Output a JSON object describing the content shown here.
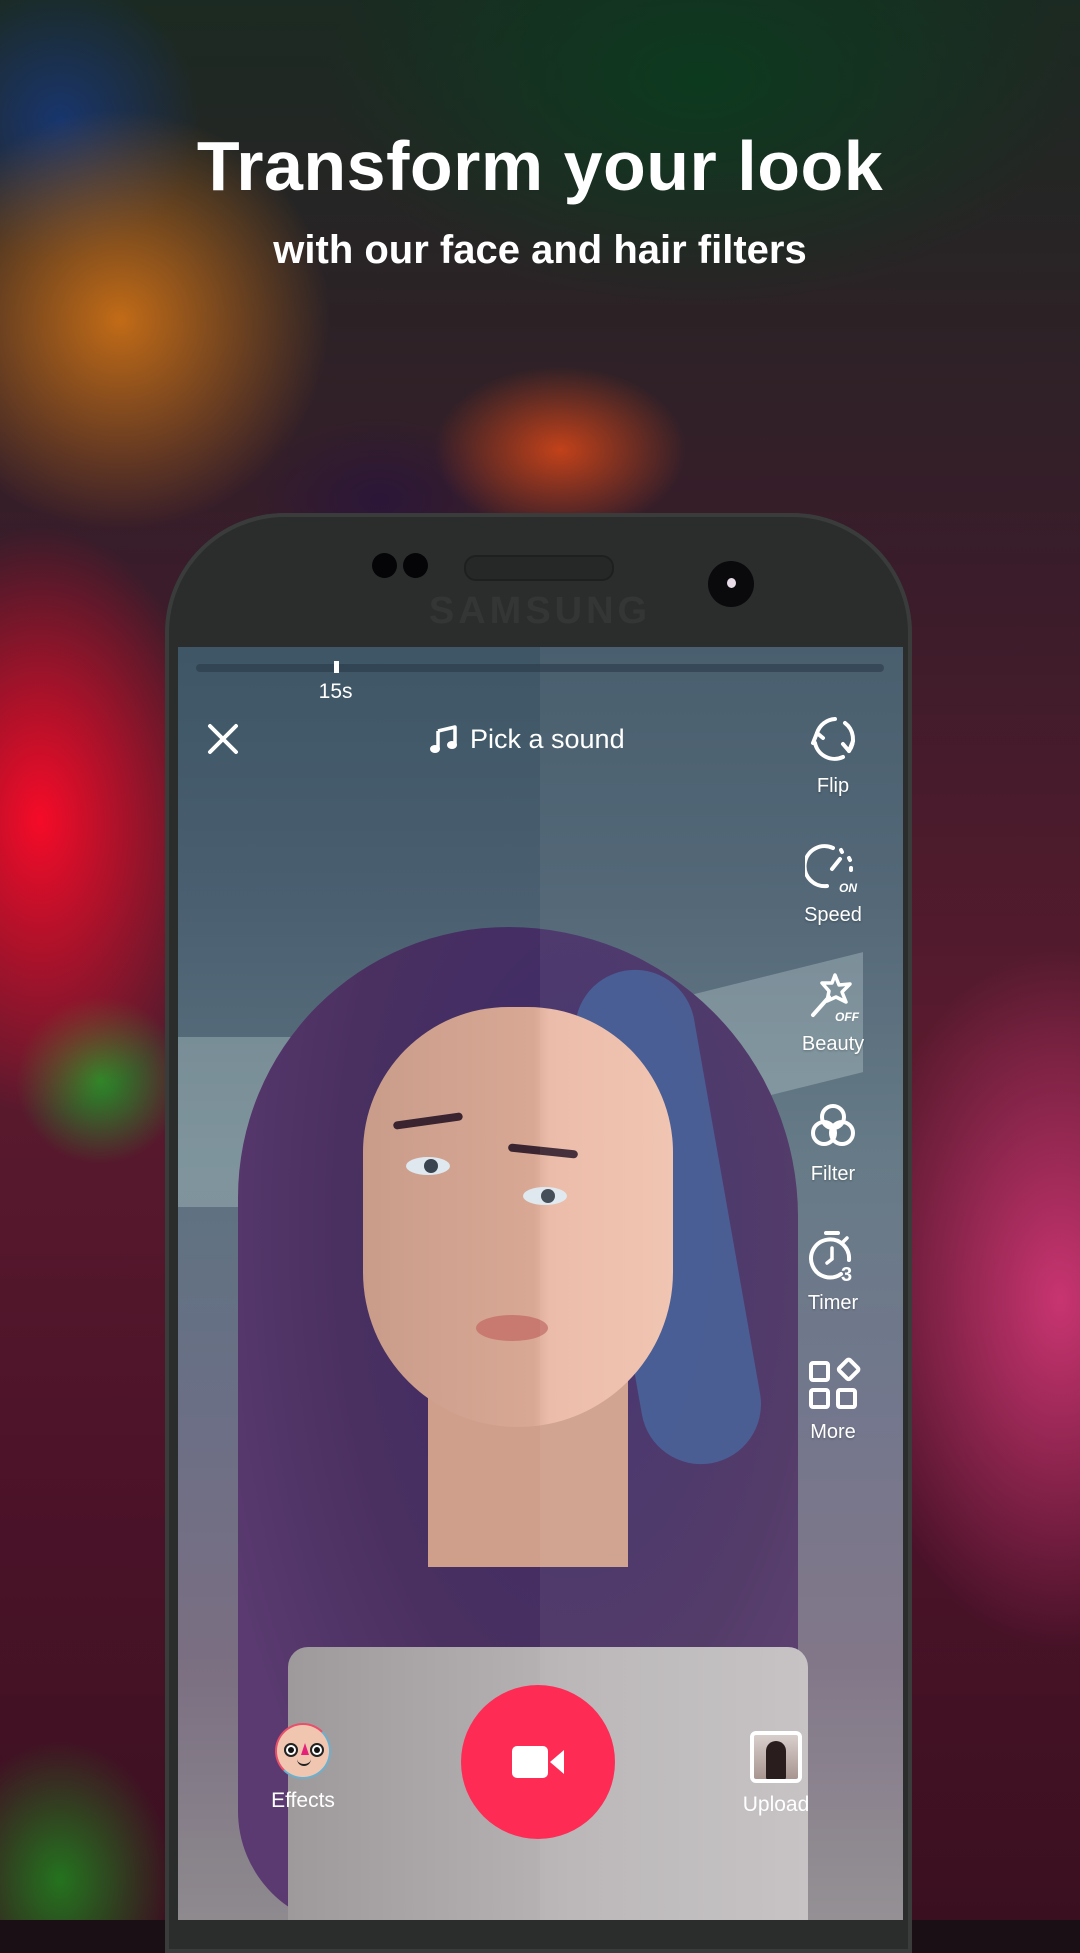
{
  "promo": {
    "headline": "Transform your look",
    "subline": "with our face and hair filters"
  },
  "device": {
    "brand": "SAMSUNG"
  },
  "camera": {
    "progress": {
      "duration_label": "15s",
      "marker_fraction": 0.2
    },
    "top_bar": {
      "close_icon": "close-icon",
      "sound_label": "Pick a sound",
      "sound_icon": "music-note-icon"
    },
    "tools": [
      {
        "label": "Flip",
        "icon": "flip-camera-icon"
      },
      {
        "label": "Speed",
        "icon": "speed-icon",
        "state": "ON"
      },
      {
        "label": "Beauty",
        "icon": "magic-wand-icon",
        "state": "OFF"
      },
      {
        "label": "Filter",
        "icon": "filter-icon"
      },
      {
        "label": "Timer",
        "icon": "timer-icon",
        "value": "3"
      },
      {
        "label": "More",
        "icon": "more-grid-icon"
      }
    ],
    "bottom": {
      "effects_label": "Effects",
      "upload_label": "Upload",
      "record_icon": "video-camera-icon"
    },
    "colors": {
      "record": "#fe2c55"
    }
  }
}
